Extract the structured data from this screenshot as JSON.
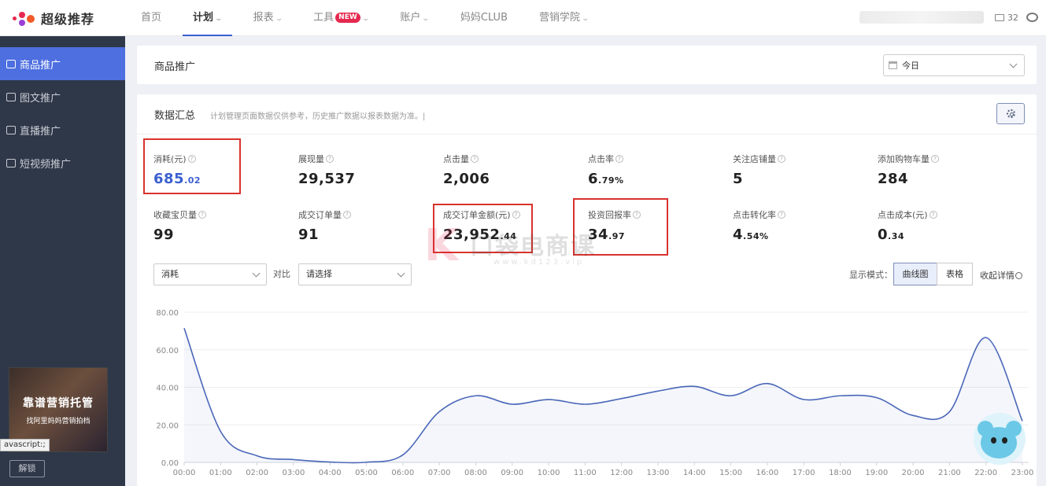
{
  "app": {
    "logo_text": "超级推荐"
  },
  "nav": {
    "items": [
      {
        "label": "首页",
        "active": false,
        "caret": false
      },
      {
        "label": "计划",
        "active": true,
        "caret": true
      },
      {
        "label": "报表",
        "active": false,
        "caret": true
      },
      {
        "label": "工具",
        "active": false,
        "caret": true,
        "badge": "NEW"
      },
      {
        "label": "账户",
        "active": false,
        "caret": true
      },
      {
        "label": "妈妈CLUB",
        "active": false,
        "caret": false
      },
      {
        "label": "营销学院",
        "active": false,
        "caret": true
      }
    ],
    "message_count": "32"
  },
  "sidebar": {
    "items": [
      {
        "label": "商品推广",
        "active": true
      },
      {
        "label": "图文推广",
        "active": false
      },
      {
        "label": "直播推广",
        "active": false
      },
      {
        "label": "短视频推广",
        "active": false
      }
    ],
    "ad": {
      "title": "靠谱营销托管",
      "subtitle": "找阿里妈妈营销拍档"
    },
    "unlock_label": "解锁",
    "status_tip": "avascript:;"
  },
  "header": {
    "title": "商品推广",
    "date_select": "今日"
  },
  "summary": {
    "title": "数据汇总",
    "note": "计划管理页面数据仅供参考，历史推广数据以报表数据为准。|",
    "help_glyph": "?",
    "metrics": [
      {
        "label": "消耗(元)",
        "int": "685",
        "dec": ".02",
        "blue": true
      },
      {
        "label": "展现量",
        "int": "29,537",
        "dec": ""
      },
      {
        "label": "点击量",
        "int": "2,006",
        "dec": ""
      },
      {
        "label": "点击率",
        "int": "6",
        "dec": ".79%"
      },
      {
        "label": "关注店铺量",
        "int": "5",
        "dec": ""
      },
      {
        "label": "添加购物车量",
        "int": "284",
        "dec": ""
      },
      {
        "label": "收藏宝贝量",
        "int": "99",
        "dec": ""
      },
      {
        "label": "成交订单量",
        "int": "91",
        "dec": ""
      },
      {
        "label": "成交订单金额(元)",
        "int": "23,952",
        "dec": ".44"
      },
      {
        "label": "投资回报率",
        "int": "34",
        "dec": ".97"
      },
      {
        "label": "点击转化率",
        "int": "4",
        "dec": ".54%"
      },
      {
        "label": "点击成本(元)",
        "int": "0",
        "dec": ".34"
      }
    ]
  },
  "controls": {
    "metric_select": "消耗",
    "compare_label": "对比",
    "compare_select": "请选择",
    "display_mode_label": "显示模式：",
    "mode_curve": "曲线图",
    "mode_table": "表格",
    "collapse_label": "收起详情"
  },
  "watermark": {
    "letter": "K",
    "text": "口袋电商课",
    "url": "www.kd123.vip"
  },
  "colors": {
    "accent": "#3b5fd0",
    "line": "#4a67b8",
    "highlight": "#d9322d",
    "brand": "#e6294f"
  },
  "chart_data": {
    "type": "line",
    "x": [
      "00:00",
      "01:00",
      "02:00",
      "03:00",
      "04:00",
      "05:00",
      "06:00",
      "07:00",
      "08:00",
      "09:00",
      "10:00",
      "11:00",
      "12:00",
      "13:00",
      "14:00",
      "15:00",
      "16:00",
      "17:00",
      "18:00",
      "19:00",
      "20:00",
      "21:00",
      "22:00",
      "23:00"
    ],
    "y_ticks": [
      "80.00",
      "60.00",
      "40.00",
      "20.00",
      "0.00"
    ],
    "ylim": [
      0,
      80
    ],
    "series": [
      {
        "values": [
          71.5,
          16.5,
          3.5,
          1.5,
          0.2,
          0.1,
          4.0,
          27.0,
          35.5,
          31.0,
          33.5,
          31.0,
          34.0,
          38.0,
          40.5,
          35.5,
          42.0,
          33.5,
          35.5,
          34.5,
          25.0,
          27.0,
          66.5,
          22.0
        ]
      }
    ],
    "grid": true
  }
}
